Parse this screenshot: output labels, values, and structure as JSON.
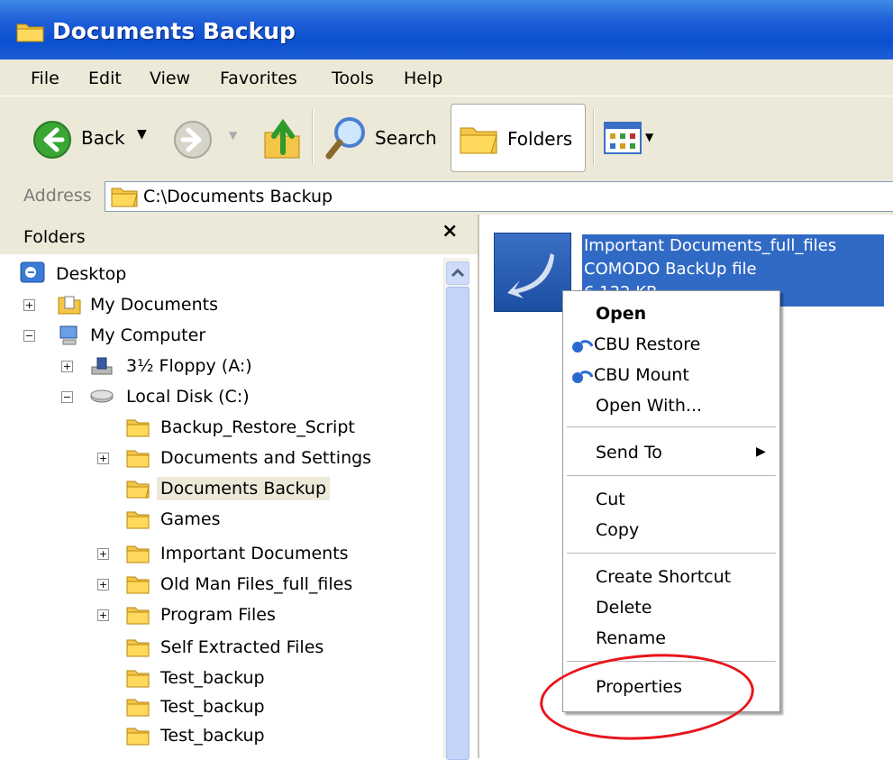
{
  "window": {
    "title": "Documents Backup"
  },
  "menubar": {
    "items": [
      "File",
      "Edit",
      "View",
      "Favorites",
      "Tools",
      "Help"
    ]
  },
  "toolbar": {
    "back_label": "Back",
    "search_label": "Search",
    "folders_label": "Folders"
  },
  "address": {
    "label": "Address",
    "value": "C:\\Documents Backup"
  },
  "folders_pane": {
    "title": "Folders",
    "close_glyph": "×",
    "tree": [
      {
        "label": "Desktop",
        "icon": "desktop-icon",
        "expander": ""
      },
      {
        "label": "My Documents",
        "icon": "my-documents-icon",
        "expander": "+"
      },
      {
        "label": "My Computer",
        "icon": "my-computer-icon",
        "expander": "−"
      },
      {
        "label": "3½ Floppy (A:)",
        "icon": "floppy-drive-icon",
        "expander": "+"
      },
      {
        "label": "Local Disk (C:)",
        "icon": "local-disk-icon",
        "expander": "−"
      },
      {
        "label": "Backup_Restore_Script",
        "icon": "folder-icon",
        "expander": ""
      },
      {
        "label": "Documents and Settings",
        "icon": "folder-icon",
        "expander": "+"
      },
      {
        "label": "Documents Backup",
        "icon": "folder-open-icon",
        "expander": "",
        "selected": true
      },
      {
        "label": "Games",
        "icon": "folder-icon",
        "expander": ""
      },
      {
        "label": "Important Documents",
        "icon": "folder-icon",
        "expander": "+"
      },
      {
        "label": "Old Man Files_full_files",
        "icon": "folder-icon",
        "expander": "+"
      },
      {
        "label": "Program Files",
        "icon": "folder-icon",
        "expander": "+"
      },
      {
        "label": "Self Extracted Files",
        "icon": "folder-icon",
        "expander": ""
      },
      {
        "label": "Test_backup",
        "icon": "folder-icon",
        "expander": ""
      },
      {
        "label": "Test_backup",
        "icon": "folder-icon",
        "expander": ""
      },
      {
        "label": "Test_backup",
        "icon": "folder-icon",
        "expander": ""
      }
    ]
  },
  "file": {
    "name": "Important Documents_full_files",
    "type": "COMODO BackUp file",
    "size": "6,132 KB",
    "icon": "comodo-backup-file-icon"
  },
  "context_menu": {
    "items": [
      {
        "label": "Open",
        "bold": true
      },
      {
        "label": "CBU Restore",
        "icon": "cbu-restore-icon"
      },
      {
        "label": "CBU Mount",
        "icon": "cbu-mount-icon"
      },
      {
        "label": "Open With..."
      },
      {
        "label": "Send To",
        "submenu": true
      },
      {
        "label": "Cut"
      },
      {
        "label": "Copy"
      },
      {
        "label": "Create Shortcut"
      },
      {
        "label": "Delete"
      },
      {
        "label": "Rename"
      },
      {
        "label": "Properties",
        "highlighted": true
      }
    ]
  },
  "colors": {
    "title_bar": "#0a4fd0",
    "selection": "#316ac5",
    "highlight_circle": "#e8141c"
  }
}
